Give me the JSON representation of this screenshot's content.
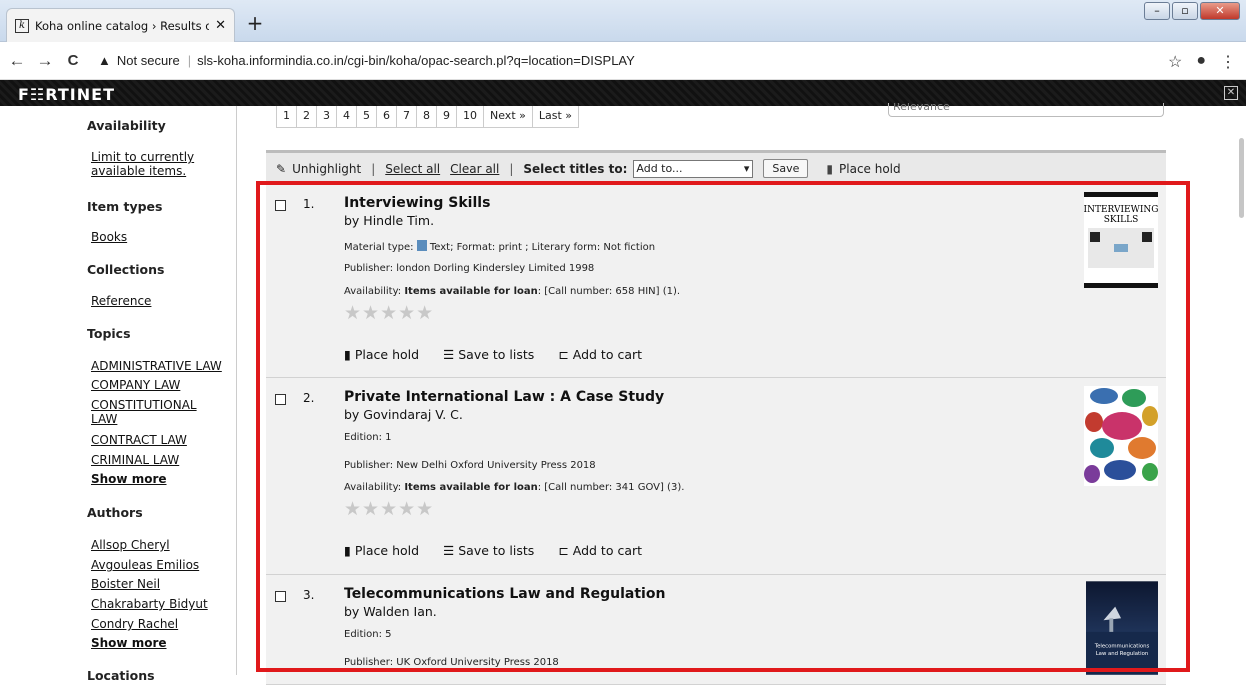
{
  "browser": {
    "tab_title": "Koha online catalog › Results of s",
    "tab_close": "✕",
    "new_tab": "+",
    "security_label": "Not secure",
    "url": "sls-koha.informindia.co.in/cgi-bin/koha/opac-search.pl?q=location=DISPLAY",
    "back": "←",
    "forward": "→",
    "reload": "C"
  },
  "fortinet": {
    "logo": "F☷RTINET",
    "close": "✕"
  },
  "sidebar": {
    "availability_heading": "Availability",
    "availability_link_1": "Limit to currently",
    "availability_link_2": "available items.",
    "item_types_heading": "Item types",
    "item_type_1": "Books",
    "collections_heading": "Collections",
    "collection_1": "Reference",
    "topics_heading": "Topics",
    "topic_1": "ADMINISTRATIVE LAW",
    "topic_2": "COMPANY LAW",
    "topic_3a": "CONSTITUTIONAL",
    "topic_3b": "LAW",
    "topic_4": "CONTRACT LAW",
    "topic_5": "CRIMINAL LAW",
    "topics_more": "Show more",
    "authors_heading": "Authors",
    "author_1": "Allsop Cheryl",
    "author_2": "Avgouleas Emilios",
    "author_3": "Boister Neil",
    "author_4": "Chakrabarty Bidyut",
    "author_5": "Condry Rachel",
    "authors_more": "Show more",
    "locations_heading": "Locations"
  },
  "pager": {
    "pages": [
      "1",
      "2",
      "3",
      "4",
      "5",
      "6",
      "7",
      "8",
      "9",
      "10"
    ],
    "next": "Next »",
    "last": "Last »"
  },
  "sort": {
    "selected": "Relevance"
  },
  "toolbar": {
    "unhighlight": "Unhighlight",
    "select_all": "Select all",
    "clear_all": "Clear all",
    "select_titles": "Select titles to:",
    "add_to": "Add to...",
    "save": "Save",
    "place_hold": "Place hold"
  },
  "results": [
    {
      "num": "1.",
      "title": "Interviewing Skills",
      "author": "by Hindle Tim.",
      "material": "Material type: ",
      "material_rest": " Text; Format: print ; Literary form: Not fiction",
      "publisher": "Publisher: london Dorling Kindersley Limited 1998",
      "avail_label": "Availability: ",
      "avail_bold": "Items available for loan",
      "avail_rest": ": [Call number: 658 HIN] (1).",
      "cover_title_1": "INTERVIEWING",
      "cover_title_2": "SKILLS"
    },
    {
      "num": "2.",
      "title": "Private International Law : A Case Study",
      "author": "by Govindaraj V. C.",
      "edition": "Edition: 1",
      "publisher": "Publisher: New Delhi Oxford University Press 2018",
      "avail_label": "Availability: ",
      "avail_bold": "Items available for loan",
      "avail_rest": ": [Call number: 341 GOV] (3)."
    },
    {
      "num": "3.",
      "title": "Telecommunications Law and Regulation",
      "author": "by Walden Ian.",
      "edition": "Edition: 5",
      "publisher": "Publisher: UK Oxford University Press 2018",
      "cover_title_1": "Telecommunications",
      "cover_title_2": "Law and Regulation"
    }
  ],
  "actions": {
    "place_hold": "Place hold",
    "save_to_lists": "Save to lists",
    "add_to_cart": "Add to cart"
  },
  "stars": "★★★★★",
  "colors": {
    "highlight_box": "#e0191b",
    "result_bg": "#f1f1f1"
  }
}
